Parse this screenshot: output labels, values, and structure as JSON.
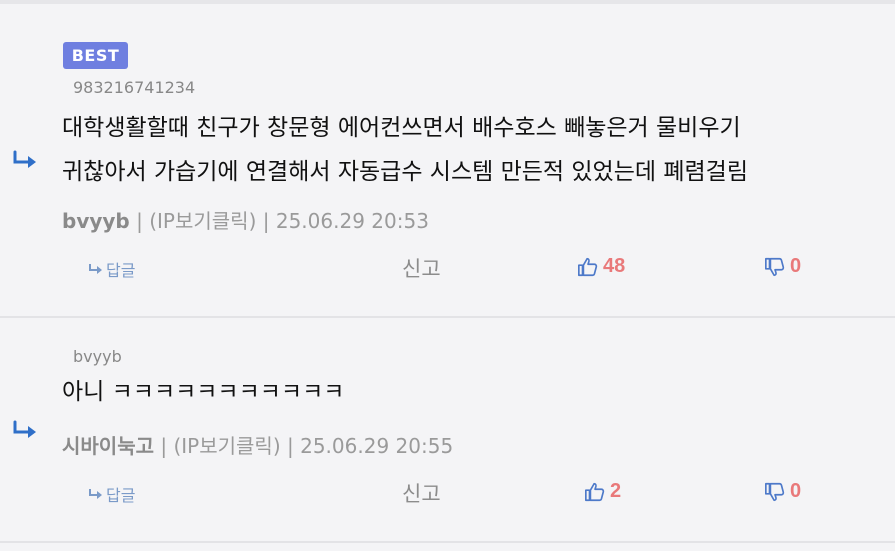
{
  "comments": [
    {
      "badge": "BEST",
      "tag": "983216741234",
      "body_line1": "대학생활할때 친구가 창문형 에어컨쓰면서 배수호스 빼놓은거 물비우기",
      "body_line2": "귀찮아서 가습기에 연결해서 자동급수 시스템 만든적 있었는데 폐렴걸림",
      "nickname": "bvyyb",
      "ip": "(IP보기클릭)",
      "datetime": "25.06.29 20:53",
      "reply_label": "답글",
      "report_label": "신고",
      "likes": "48",
      "dislikes": "0"
    },
    {
      "tag": "bvyyb",
      "body_line1": "아니 ㅋㅋㅋㅋㅋㅋㅋㅋㅋㅋㅋ",
      "nickname": "시바이눅고",
      "ip": "(IP보기클릭)",
      "datetime": "25.06.29 20:55",
      "reply_label": "답글",
      "report_label": "신고",
      "likes": "2",
      "dislikes": "0"
    }
  ],
  "colors": {
    "accent": "#6f7fe0",
    "like": "#e9797a",
    "icon": "#4d79c9"
  },
  "icons": {
    "reply_arrow": "reply-arrow-icon",
    "thumb_up": "thumbs-up-icon",
    "thumb_down": "thumbs-down-icon"
  }
}
